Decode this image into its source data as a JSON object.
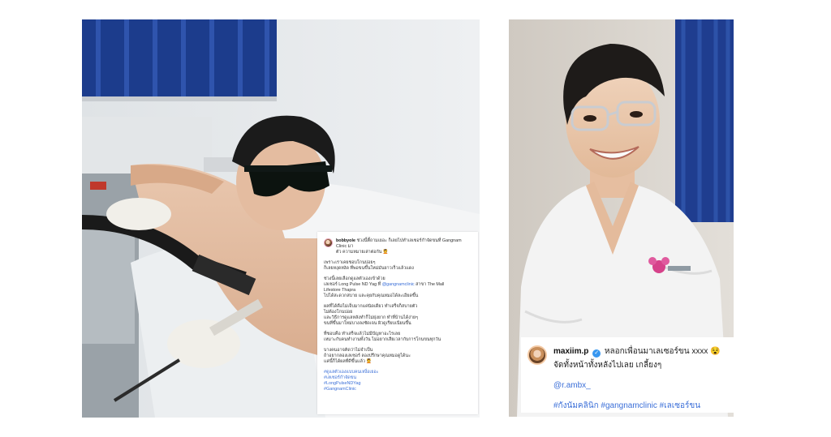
{
  "left_post": {
    "username": "bobbyole",
    "intro": "ช่วงนี้ตี้ถามเยอะ ก็เลยไปทำเลเซอร์กำจัดขนที่ Gangnam Clinic มา",
    "intro2": "ตัว ความหมายเล่าต่อกัน 💆",
    "para1_l1": "เพราะเราเคยชอบโกนบ่อยๆ",
    "para1_l2": "ก็เลยหงุดหงิด ที่พอขนขึ้นใหม่มันยาวเร็วแล้วแดง",
    "para2_l1": "ช่วงนี้เลยเลือกดูแลตัวเองเข้าด้วย",
    "para2_l2_pre": "เลเซอร์ Long Pulse ND Yag ที่ ",
    "para2_mention": "@gangnamclinic",
    "para2_l2_post": " สาขา The Mall",
    "para2_l3": "Lifestore Thapra",
    "para2_l4": "ไปได้สะดวกสบาย และคุยกับคุณหมอได้ละเอียดขึ้น",
    "para3_l1": "ผลที่ได้คือไม่เจ็บมากแค่นิดเดียว ทำเสร็จก็สบายตัว",
    "para3_l2": "ไม่ต้องโกนบ่อย",
    "para3_l3": "และวิธีการดูแลหลังทำก็ไม่ยุ่งยาก ทำที่บ้านได้ง่ายๆ",
    "para3_l4": "ขนที่ขึ้นมาใหม่บางลงชัดเจน ผิวดูเรียบเนียนขึ้น",
    "para4_l1": "ที่ชอบคือ ทำเสร็จแล้วไม่มีปัญหาอะไรเลย",
    "para4_l2": "เหมาะกับคนทำงานทั้งวัน ไม่อยากเสียเวลากับการโกนขนทุกวัน",
    "para5_l1": "บางคนอาจคิดว่าไม่จำเป็น",
    "para5_l2": "ถ้าอยากลองเลเซอร์ ลองปรึกษาคุณหมอดูได้นะ",
    "para5_l3": "แค่นี้ก็ได้ผลที่ดีขึ้นแล้ว 💆",
    "hashtags": [
      "#ดูแลตัวเองแบบคนเหงื่อเยอะ",
      "#เลเซอร์กำจัดขน",
      "#LongPulseNDYag",
      "#GangnamClinic"
    ]
  },
  "right_post": {
    "username": "maxiim.p",
    "verified_icon": "✓",
    "text1": "หลอกเพื่อนมาเลเซอร์ขน xxxx 😵",
    "text2": "จัดทั้งหน้าทั้งหลังไปเลย เกลี้ยงๆ",
    "mention": "@r.ambx_",
    "hashtags": "#กังนัมคลินิก #gangnamclinic #เลเซอร์ขน"
  },
  "colors": {
    "link": "#3b6fd8",
    "verified": "#3897f0",
    "curtain": "#1f3d8f",
    "robe": "#f2f2f2"
  }
}
